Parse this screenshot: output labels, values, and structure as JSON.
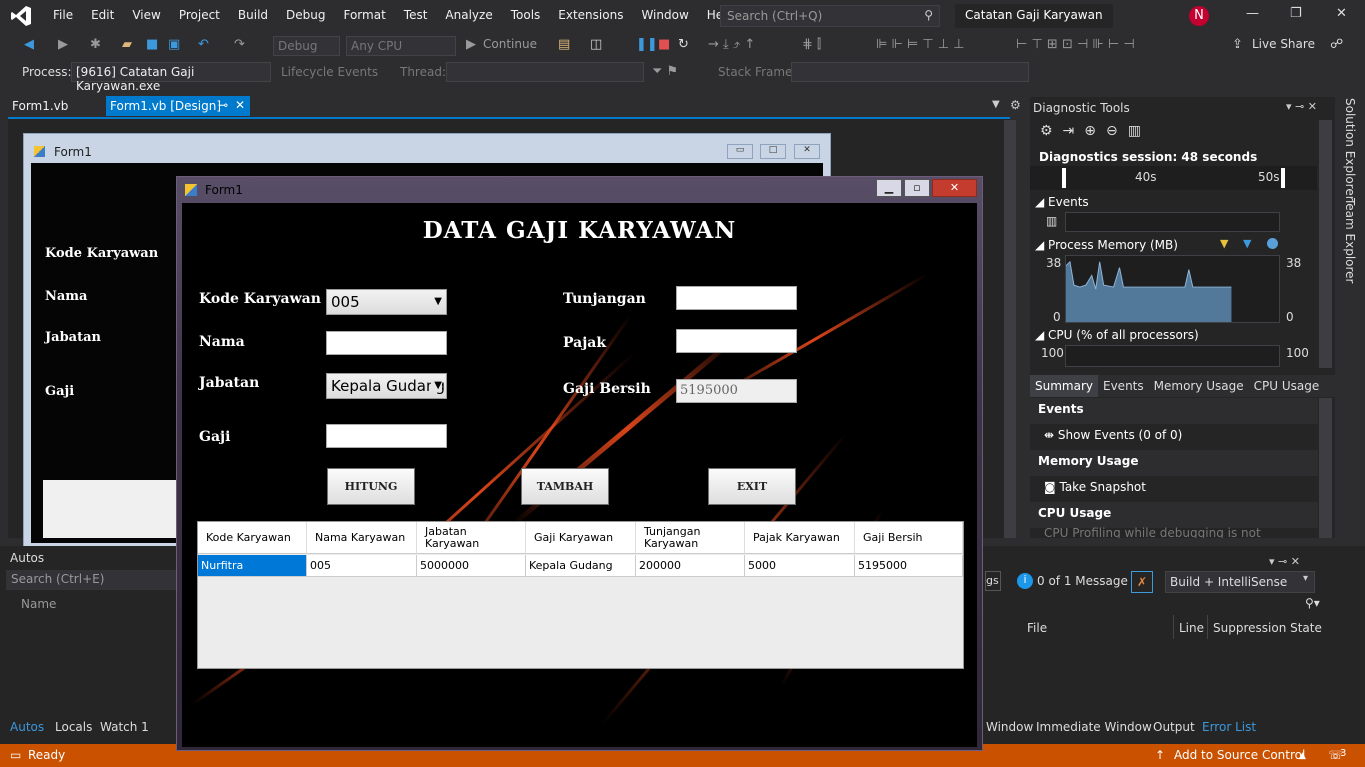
{
  "menu": {
    "items": [
      "File",
      "Edit",
      "View",
      "Project",
      "Build",
      "Debug",
      "Format",
      "Test",
      "Analyze",
      "Tools",
      "Extensions",
      "Window",
      "Help"
    ],
    "search_placeholder": "Search (Ctrl+Q)",
    "solution_title": "Catatan Gaji Karyawan",
    "avatar_initial": "N"
  },
  "toolbar": {
    "config": "Debug",
    "platform": "Any CPU",
    "continue": "Continue",
    "live_share": "Live Share"
  },
  "toolbar2": {
    "process_label": "Process:",
    "process_value": "[9616] Catatan Gaji Karyawan.exe",
    "lifecycle": "Lifecycle Events",
    "thread_label": "Thread:",
    "stackframe_label": "Stack Frame:"
  },
  "tabs": {
    "tab1": "Form1.vb",
    "tab2": "Form1.vb [Design]"
  },
  "bgform": {
    "title": "Form1",
    "labels": [
      "Kode Karyawan",
      "Nama",
      "Jabatan",
      "Gaji"
    ]
  },
  "diag": {
    "header": "Diagnostic Tools",
    "session": "Diagnostics session: 48 seconds",
    "t1": "40s",
    "t2": "50s",
    "events": "Events",
    "memory": "Process Memory (MB)",
    "mem_max": "38",
    "mem_min": "0",
    "cpu": "CPU (% of all processors)",
    "cpu_max": "100",
    "tabs": [
      "Summary",
      "Events",
      "Memory Usage",
      "CPU Usage"
    ],
    "s_events": "Events",
    "s_show_events": "Show Events (0 of 0)",
    "s_memory": "Memory Usage",
    "s_snapshot": "Take Snapshot",
    "s_cpu": "CPU Usage",
    "s_cpu_note": "CPU Profiling while debugging is not availabl"
  },
  "side": {
    "solution": "Solution Explorer",
    "team": "Team Explorer"
  },
  "autos": {
    "title": "Autos",
    "search": "Search (Ctrl+E)",
    "name_col": "Name"
  },
  "errlist": {
    "messages": "0 of 1 Message",
    "filter": "Build + IntelliSense",
    "warnings_tail": "gs",
    "cols": [
      "File",
      "Line",
      "Suppression State"
    ]
  },
  "bottom": {
    "tabs": [
      "Autos",
      "Locals",
      "Watch 1"
    ],
    "right_tabs": "Window",
    "immediate": "Immediate Window",
    "output": "Output",
    "error_list": "Error List"
  },
  "status": {
    "ready": "Ready",
    "source": "Add to Source Control",
    "notif": "3"
  },
  "form": {
    "title": "Form1",
    "heading": "DATA GAJI KARYAWAN",
    "lbl_kode": "Kode Karyawan",
    "lbl_nama": "Nama",
    "lbl_jabatan": "Jabatan",
    "lbl_gaji": "Gaji",
    "lbl_tunjangan": "Tunjangan",
    "lbl_pajak": "Pajak",
    "lbl_bersih": "Gaji Bersih",
    "kode_value": "005",
    "jabatan_value": "Kepala Gudang",
    "bersih_value": "5195000",
    "btn_hitung": "HITUNG",
    "btn_tambah": "TAMBAH",
    "btn_exit": "EXIT"
  },
  "grid": {
    "headers": [
      "Kode Karyawan",
      "Nama Karyawan",
      "Jabatan Karyawan",
      "Gaji Karyawan",
      "Tunjangan Karyawan",
      "Pajak Karyawan",
      "Gaji Bersih"
    ],
    "row": [
      "Nurfitra",
      "005",
      "5000000",
      "Kepala Gudang",
      "200000",
      "5000",
      "5195000"
    ]
  }
}
